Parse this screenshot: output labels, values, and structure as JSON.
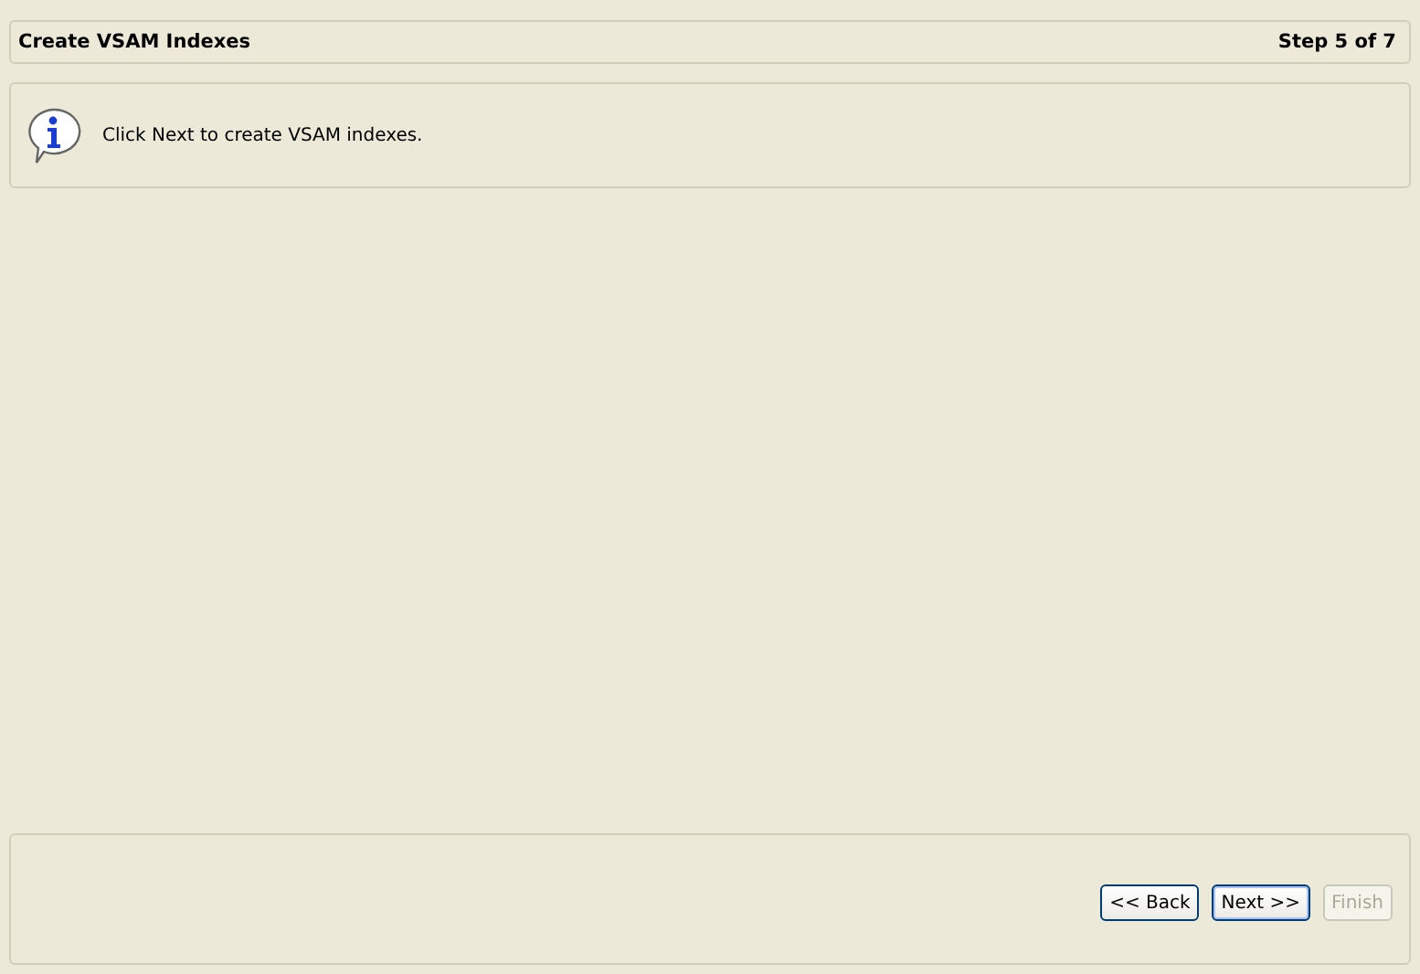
{
  "header": {
    "title": "Create VSAM Indexes",
    "step": "Step 5 of 7"
  },
  "message": {
    "text": "Click Next to create VSAM indexes."
  },
  "buttons": [
    {
      "label": "<< Back",
      "disabled": false,
      "default": false
    },
    {
      "label": "Next >>",
      "disabled": false,
      "default": true
    },
    {
      "label": "Finish",
      "disabled": true,
      "default": false
    }
  ]
}
